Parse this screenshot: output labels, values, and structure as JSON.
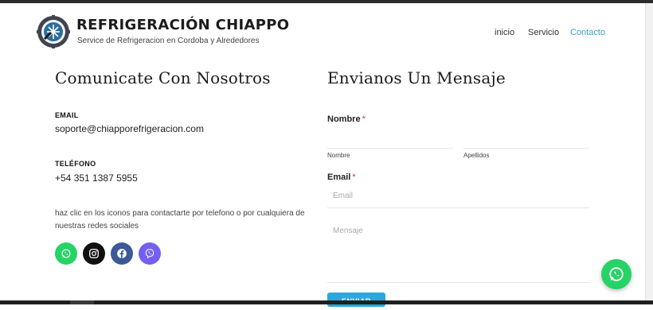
{
  "header": {
    "brand_title": "REFRIGERACIÓN CHIAPPO",
    "brand_subtitle": "Service de Refrigeracion en Cordoba y Alrededores",
    "nav": [
      {
        "label": "inicio",
        "active": false
      },
      {
        "label": "Servicio",
        "active": false
      },
      {
        "label": "Contacto",
        "active": true
      }
    ],
    "accent_color": "#3aa1c8"
  },
  "contact": {
    "title": "Comunicate Con Nosotros",
    "email_label": "EMAIL",
    "email_value": "soporte@chiapporefrigeracion.com",
    "phone_label": "TELÉFONO",
    "phone_value": "+54 351 1387 5955",
    "blurb": "haz clic en los iconos para contactarte por telefono o por cualquiera de nuestras redes sociales",
    "social": [
      {
        "icon": "whatsapp-icon",
        "color": "#25d366"
      },
      {
        "icon": "instagram-icon",
        "color": "#111111"
      },
      {
        "icon": "facebook-icon",
        "color": "#3b5998"
      },
      {
        "icon": "viber-icon",
        "color": "#7360f2"
      }
    ]
  },
  "form": {
    "title": "Envianos Un Mensaje",
    "name_label": "Nombre",
    "required_mark": "*",
    "first_name_sublabel": "Nombre",
    "last_name_sublabel": "Apellidos",
    "email_label": "Email",
    "email_placeholder": "Email",
    "message_placeholder": "Mensaje",
    "submit_label": "ENVIAR"
  },
  "floating": {
    "icon": "whatsapp-icon",
    "color": "#25d366"
  }
}
